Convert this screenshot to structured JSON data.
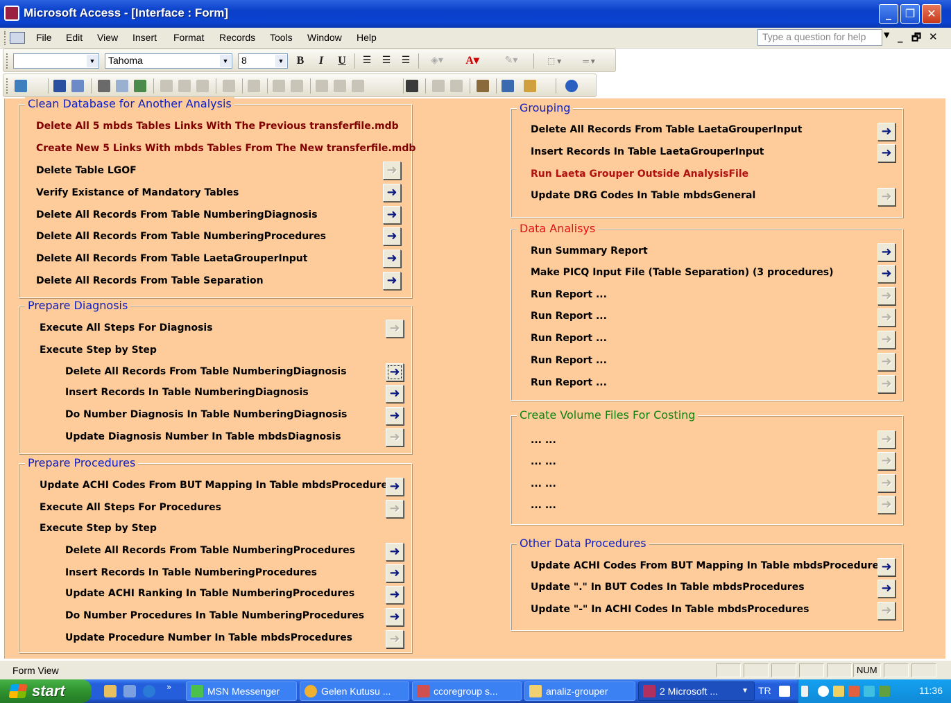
{
  "window": {
    "title": "Microsoft Access - [Interface : Form]",
    "minimize": "_",
    "restore": "❐",
    "close": "✕"
  },
  "menu": {
    "items": [
      "File",
      "Edit",
      "View",
      "Insert",
      "Format",
      "Records",
      "Tools",
      "Window",
      "Help"
    ],
    "help_placeholder": "Type a question for help",
    "mdi_min": "_",
    "mdi_restore": "🗗",
    "mdi_close": "✕"
  },
  "format_toolbar": {
    "object_combo": "",
    "font": "Tahoma",
    "size": "8",
    "bold": "B",
    "italic": "I",
    "underline": "U"
  },
  "form": {
    "arrow_glyph": "➜",
    "clean": {
      "title": "Clean Database for Another Analysis",
      "rows": [
        "Delete All 5 mbds Tables Links With The Previous transferfile.mdb",
        "Create New 5 Links With mbds Tables From The New transferfile.mdb",
        "Delete Table LGOF",
        "Verify Existance of Mandatory Tables",
        "Delete All Records From Table NumberingDiagnosis",
        "Delete All Records From Table NumberingProcedures",
        "Delete All Records From Table LaetaGrouperInput",
        "Delete All Records From Table Separation"
      ]
    },
    "diagnosis": {
      "title": "Prepare Diagnosis",
      "execute_all": "Execute All Steps For Diagnosis",
      "step_by_step": "Execute Step by Step",
      "steps": [
        "Delete All Records From Table NumberingDiagnosis",
        "Insert Records In Table NumberingDiagnosis",
        "Do Number Diagnosis In Table NumberingDiagnosis",
        "Update Diagnosis Number In Table mbdsDiagnosis"
      ]
    },
    "procedures": {
      "title": "Prepare Procedures",
      "update_achi": "Update ACHI Codes From BUT Mapping In Table mbdsProcedures",
      "execute_all": "Execute All Steps For Procedures",
      "step_by_step": "Execute Step by Step",
      "steps": [
        "Delete All Records From Table NumberingProcedures",
        "Insert Records In Table NumberingProcedures",
        "Update ACHI Ranking In Table NumberingProcedures",
        "Do Number Procedures In Table NumberingProcedures",
        "Update Procedure Number In Table mbdsProcedures"
      ]
    },
    "grouping": {
      "title": "Grouping",
      "rows": [
        "Delete All Records From Table LaetaGrouperInput",
        "Insert Records In Table LaetaGrouperInput",
        "Run Laeta Grouper Outside AnalysisFile",
        "Update DRG Codes In Table mbdsGeneral"
      ]
    },
    "analysis": {
      "title": "Data Analisys",
      "rows": [
        "Run Summary Report",
        "Make PICQ Input File (Table Separation) (3 procedures)",
        "Run Report ...",
        "Run Report ...",
        "Run Report ...",
        "Run Report ...",
        "Run Report ..."
      ]
    },
    "volume": {
      "title": "Create Volume Files For Costing",
      "rows": [
        "... ...",
        "... ...",
        "... ...",
        "... ..."
      ]
    },
    "other": {
      "title": "Other Data Procedures",
      "rows": [
        "Update ACHI Codes From BUT Mapping In Table mbdsProcedures",
        "Update \".\" In BUT Codes In Table mbdsProcedures",
        "Update \"-\" In ACHI Codes In Table mbdsProcedures"
      ]
    },
    "colors": {
      "background": "#fecc9a",
      "title_blue": "#0a1ec8",
      "title_red": "#e01010",
      "title_green": "#108010",
      "dark_red_text": "#800000"
    }
  },
  "status": {
    "text": "Form View",
    "num": "NUM"
  },
  "taskbar": {
    "start": "start",
    "tasks": [
      "MSN Messenger",
      "Gelen Kutusu ...",
      "ccoregroup s...",
      "analiz-grouper",
      "2 Microsoft ..."
    ],
    "lang": "TR",
    "clock": "11:36"
  }
}
